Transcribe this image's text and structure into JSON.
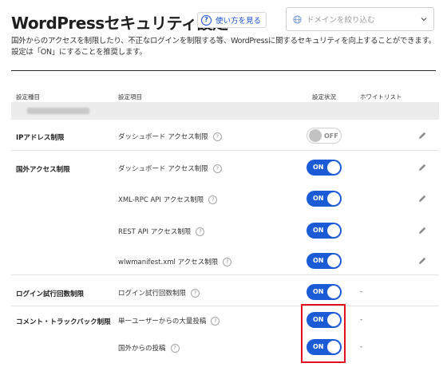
{
  "header": {
    "title": "WordPressセキュリティ設定",
    "help_label": "使い方を見る",
    "domain_filter_placeholder": "ドメインを絞り込む"
  },
  "description": {
    "line1": "国外からのアクセスを制限したり、不正なログインを制限する等、WordPressに関するセキュリティを向上することができます。",
    "line2": "設定は「ON」にすることを推奨します。"
  },
  "table": {
    "columns": {
      "category": "設定種目",
      "item": "設定項目",
      "status": "設定状況",
      "whitelist": "ホワイトリスト"
    },
    "categories": {
      "ip": "IPアドレス制限",
      "foreign": "国外アクセス制限",
      "login": "ログイン試行回数制限",
      "comment": "コメント・トラックバック制限"
    },
    "rows": [
      {
        "item": "ダッシュボード アクセス制限",
        "state": "OFF",
        "whitelist": ""
      },
      {
        "item": "ダッシュボード アクセス制限",
        "state": "ON",
        "whitelist": ""
      },
      {
        "item": "XML-RPC API アクセス制限",
        "state": "ON",
        "whitelist": ""
      },
      {
        "item": "REST API アクセス制限",
        "state": "ON",
        "whitelist": ""
      },
      {
        "item": "wlwmanifest.xml アクセス制限",
        "state": "ON",
        "whitelist": ""
      },
      {
        "item": "ログイン試行回数制限",
        "state": "ON",
        "whitelist": "-"
      },
      {
        "item": "単一ユーザーからの大量投稿",
        "state": "ON",
        "whitelist": "-"
      },
      {
        "item": "国外からの投稿",
        "state": "ON",
        "whitelist": "-"
      }
    ],
    "help_glyph": "?"
  },
  "colors": {
    "toggle_on": "#1b5bd6",
    "toggle_off_knob": "#c2c2c2",
    "link": "#1a4fd6",
    "highlight": "#e0101e"
  },
  "icons": {
    "help": "question-circle-icon",
    "domain_filter": "globe-icon",
    "dropdown": "chevron-down-icon",
    "edit": "pencil-icon"
  }
}
